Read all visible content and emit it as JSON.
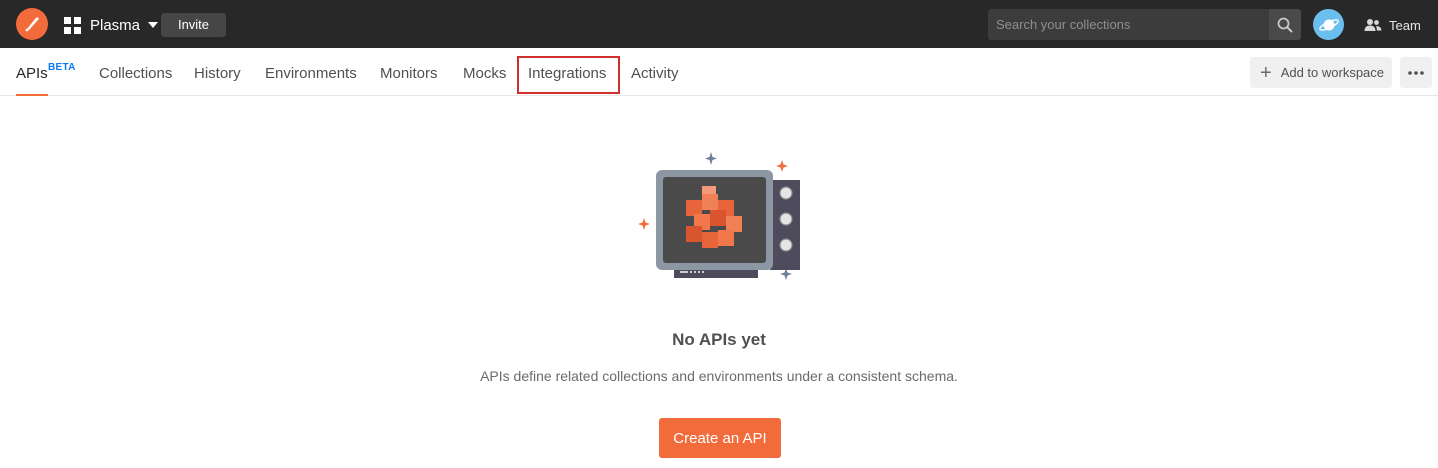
{
  "colors": {
    "topbar_bg": "#282828",
    "accent": "#f26b3a",
    "beta": "#097bed",
    "highlight": "#d0302b"
  },
  "topbar": {
    "logo_icon": "pen-nib-icon",
    "workspace_icon": "grid-icon",
    "workspace_name": "Plasma",
    "invite_label": "Invite",
    "search_placeholder": "Search your collections",
    "search_icon": "search-icon",
    "avatar_icon": "planet-avatar-icon",
    "team_icon": "people-icon",
    "team_label": "Team"
  },
  "tabs": {
    "items": [
      {
        "label": "APIs",
        "badge": "BETA",
        "active": true
      },
      {
        "label": "Collections"
      },
      {
        "label": "History"
      },
      {
        "label": "Environments"
      },
      {
        "label": "Monitors"
      },
      {
        "label": "Mocks"
      },
      {
        "label": "Integrations",
        "highlighted": true
      },
      {
        "label": "Activity"
      }
    ],
    "add_to_workspace_label": "Add to workspace",
    "more_icon": "ellipsis-icon"
  },
  "empty_state": {
    "illustration": "api-cubes-monitor-illustration",
    "title": "No APIs yet",
    "description": "APIs define related collections and environments under a consistent schema.",
    "button_label": "Create an API"
  }
}
